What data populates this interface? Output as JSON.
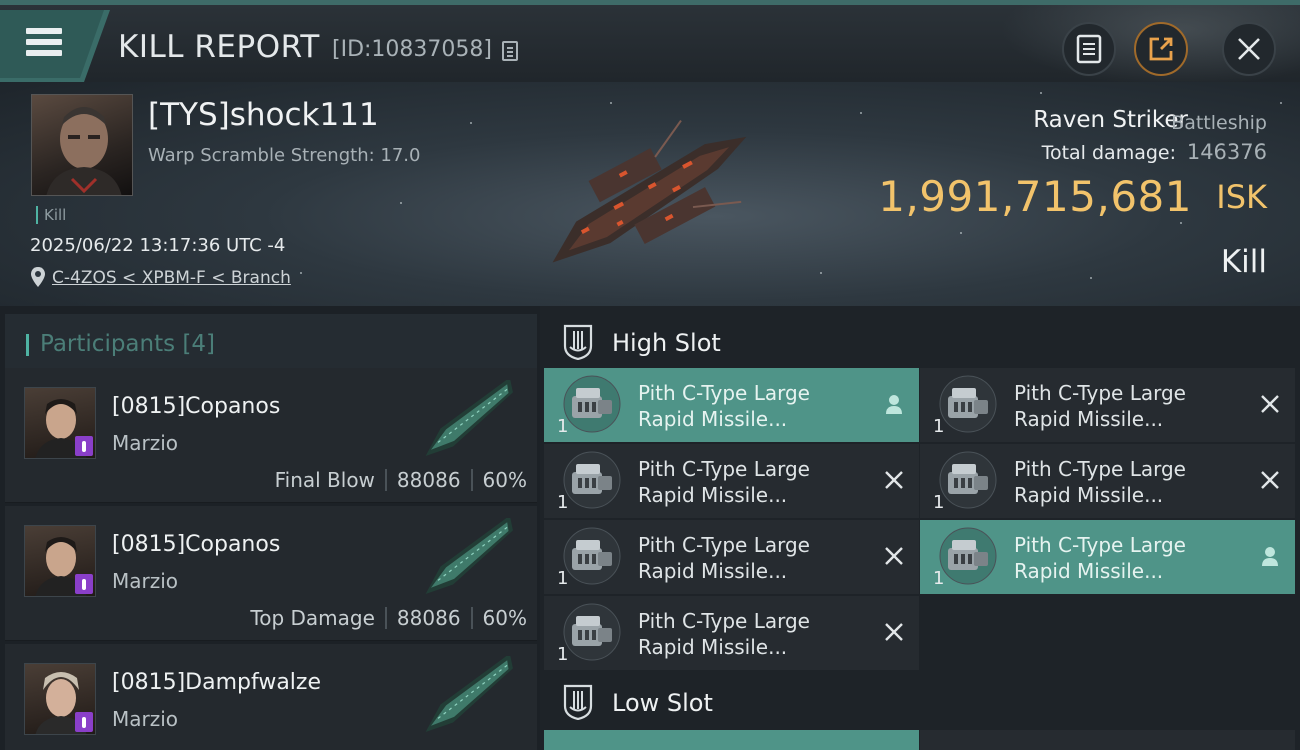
{
  "topbar": {
    "title": "KILL REPORT",
    "report_id": "[ID:10837058]",
    "icons": [
      "menu-icon",
      "copy-icon",
      "document-icon",
      "share-icon",
      "close-icon"
    ]
  },
  "victim": {
    "name": "[TYS]shock111",
    "warp_strength": "Warp Scramble Strength: 17.0",
    "tag": "Kill",
    "datetime": "2025/06/22 13:17:36 UTC -4",
    "location": "C-4ZOS < XPBM-F < Branch"
  },
  "ship": {
    "name": "Raven Striker",
    "class": "Battleship",
    "total_damage_label": "Total damage:",
    "total_damage": "146376",
    "isk_value": "1,991,715,681",
    "isk_unit": "ISK",
    "result": "Kill"
  },
  "participants": {
    "label": "Participants",
    "count": "[4]",
    "items": [
      {
        "name": "[0815]Copanos",
        "corp": "Marzio",
        "role": "Final Blow",
        "damage": "88086",
        "percent": "60%"
      },
      {
        "name": "[0815]Copanos",
        "corp": "Marzio",
        "role": "Top Damage",
        "damage": "88086",
        "percent": "60%"
      },
      {
        "name": "[0815]Dampfwalze",
        "corp": "Marzio",
        "role": "",
        "damage": "",
        "percent": ""
      }
    ]
  },
  "fitting": {
    "high_slot_label": "High Slot",
    "low_slot_label": "Low Slot",
    "high_modules": [
      {
        "line1": "Pith C-Type Large",
        "line2": "Rapid Missile...",
        "qty": "1",
        "status": "dropped"
      },
      {
        "line1": "Pith C-Type Large",
        "line2": "Rapid Missile...",
        "qty": "1",
        "status": "destroyed"
      },
      {
        "line1": "Pith C-Type Large",
        "line2": "Rapid Missile...",
        "qty": "1",
        "status": "destroyed"
      },
      {
        "line1": "Pith C-Type Large",
        "line2": "Rapid Missile...",
        "qty": "1",
        "status": "destroyed"
      },
      {
        "line1": "Pith C-Type Large",
        "line2": "Rapid Missile...",
        "qty": "1",
        "status": "destroyed"
      },
      {
        "line1": "Pith C-Type Large",
        "line2": "Rapid Missile...",
        "qty": "1",
        "status": "dropped"
      },
      {
        "line1": "Pith C-Type Large",
        "line2": "Rapid Missile...",
        "qty": "1",
        "status": "destroyed"
      }
    ]
  },
  "colors": {
    "accent": "#4fb3a3",
    "isk": "#f2c36b",
    "highlight": "#4f9488",
    "badge": "#8a3fc9"
  }
}
